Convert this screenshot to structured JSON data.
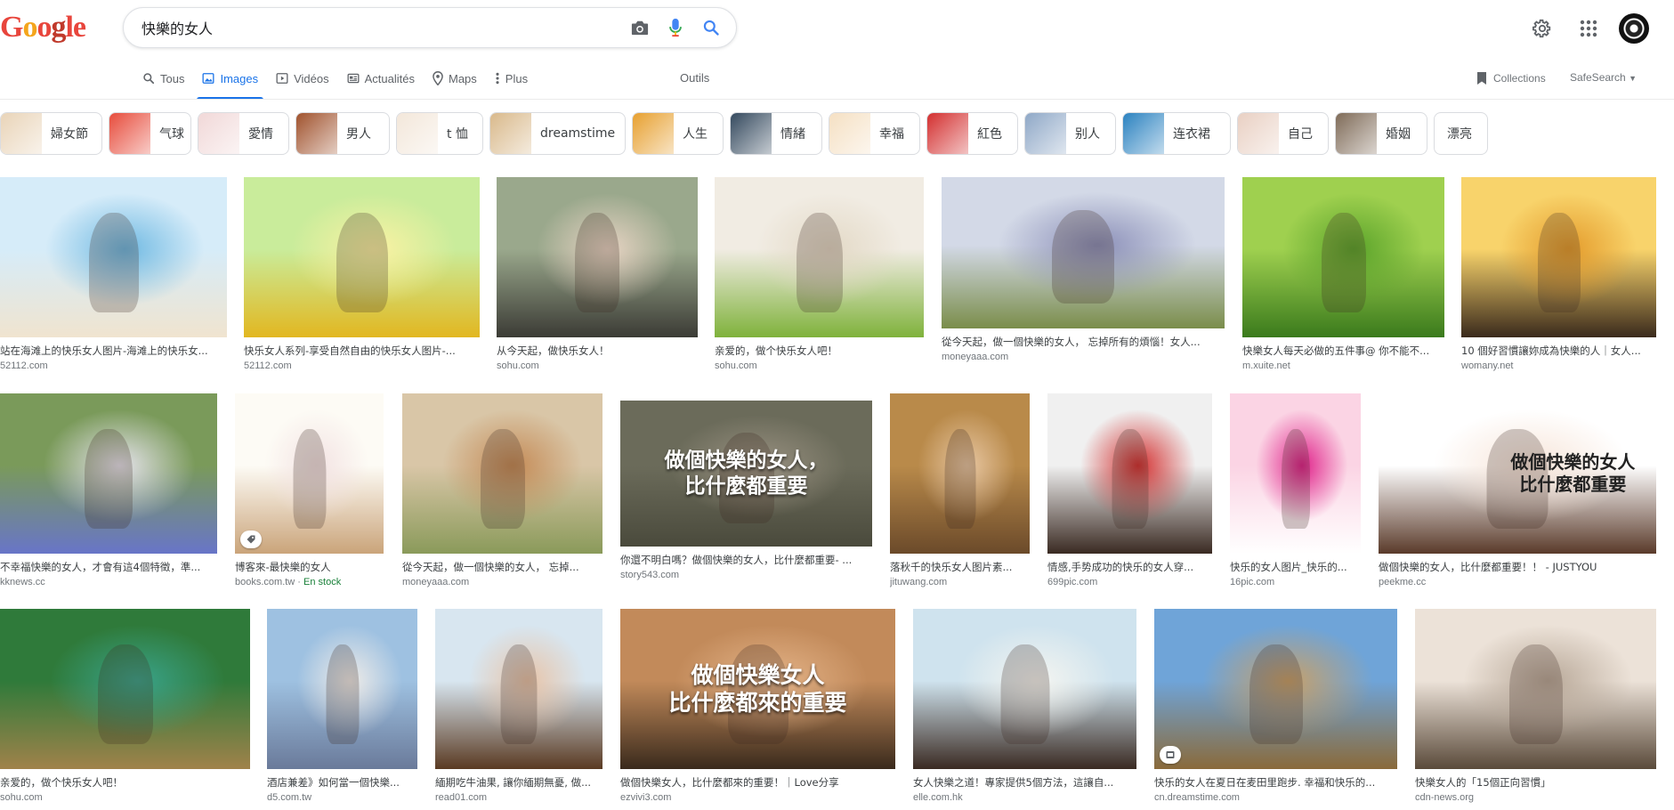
{
  "app": {
    "logo": [
      "G",
      "o",
      "o",
      "g",
      "l",
      "e"
    ],
    "logo_colors": [
      "#e8453c",
      "#f4a51c",
      "#e8453c",
      "#c0392b",
      "#e8453c",
      "#e8453c"
    ]
  },
  "search": {
    "query": "快樂的女人",
    "placeholder": ""
  },
  "tabs": [
    {
      "label": "Tous",
      "icon": "search-icon",
      "active": false
    },
    {
      "label": "Images",
      "icon": "image-icon",
      "active": true
    },
    {
      "label": "Vidéos",
      "icon": "play-icon",
      "active": false
    },
    {
      "label": "Actualités",
      "icon": "news-icon",
      "active": false
    },
    {
      "label": "Maps",
      "icon": "map-pin-icon",
      "active": false
    },
    {
      "label": "Plus",
      "icon": "more-vert-icon",
      "active": false
    }
  ],
  "tools_label": "Outils",
  "collections_label": "Collections",
  "safesearch_label": "SafeSearch",
  "chips": [
    {
      "label": "婦女節",
      "color": "#e9d4b8"
    },
    {
      "label": "气球",
      "color": "#e74c3c"
    },
    {
      "label": "愛情",
      "color": "#f1d8d8"
    },
    {
      "label": "男人",
      "color": "#a0522d"
    },
    {
      "label": "t 恤",
      "color": "#f3e7da"
    },
    {
      "label": "dreamstime",
      "color": "#d9b98b"
    },
    {
      "label": "人生",
      "color": "#e7a030"
    },
    {
      "label": "情緒",
      "color": "#34495e"
    },
    {
      "label": "幸福",
      "color": "#f5e0c3"
    },
    {
      "label": "紅色",
      "color": "#d32f2f"
    },
    {
      "label": "别人",
      "color": "#8fa8c7"
    },
    {
      "label": "连衣裙",
      "color": "#2b82c0"
    },
    {
      "label": "自己",
      "color": "#e9d0c3"
    },
    {
      "label": "婚姻",
      "color": "#7f6b58"
    },
    {
      "label": "漂亮",
      "color": ""
    }
  ],
  "results": [
    {
      "caption": "站在海滩上的快乐女人图片-海滩上的快乐女...",
      "source": "52112.com",
      "colors": [
        "#d6ecf9",
        "#6fb9e2",
        "#f0e4cf"
      ]
    },
    {
      "caption": "快乐女人系列-享受自然自由的快乐女人图片-...",
      "source": "52112.com",
      "colors": [
        "#c9ec9b",
        "#fbf2a3",
        "#e2b720"
      ]
    },
    {
      "caption": "从今天起，做快乐女人！",
      "source": "sohu.com",
      "colors": [
        "#9aa88c",
        "#e8d4c4",
        "#3b3b35"
      ]
    },
    {
      "caption": "亲爱的，做个快乐女人吧！",
      "source": "sohu.com",
      "colors": [
        "#f1ece3",
        "#e3d9c6",
        "#7fb23b"
      ]
    },
    {
      "caption": "從今天起，做一個快樂的女人， 忘掉所有的煩惱！女人...",
      "source": "moneyaaa.com",
      "colors": [
        "#d3d9e7",
        "#8b8fb8",
        "#7a8d4a"
      ]
    },
    {
      "caption": "快樂女人每天必做的五件事@ 你不能不...",
      "source": "m.xuite.net",
      "colors": [
        "#9fd04f",
        "#5aa32a",
        "#3a7a1c"
      ]
    },
    {
      "caption": "10 個好習慣讓妳成為快樂的人｜女人...",
      "source": "womany.net",
      "colors": [
        "#f8d36b",
        "#e49b2b",
        "#3a2a1c"
      ]
    },
    {
      "caption": "不幸福快樂的女人，才會有這4個特徵，準...",
      "source": "kknews.cc",
      "colors": [
        "#7a9a5a",
        "#e7e4ee",
        "#6875c8"
      ]
    },
    {
      "caption": "博客來-最快樂的女人",
      "source": "books.com.tw",
      "stock": "En stock",
      "colors": [
        "#fdfbf5",
        "#f3e3e3",
        "#caa47a"
      ]
    },
    {
      "caption": "從今天起，做一個快樂的女人， 忘掉...",
      "source": "moneyaaa.com",
      "colors": [
        "#d9c6a7",
        "#c48a55",
        "#8a9a5a"
      ]
    },
    {
      "caption": "你還不明白嗎？做個快樂的女人，比什麼都重要- ...",
      "source": "story543.com",
      "colors": [
        "#6b6b5a",
        "#9a9282",
        "#4a4a3c"
      ],
      "overlay": "做個快樂的女人，\n比什麼都重要"
    },
    {
      "caption": "落秋千的快乐女人图片素...",
      "source": "jituwang.com",
      "colors": [
        "#b98a4a",
        "#e8c7a3",
        "#6b4a2a"
      ]
    },
    {
      "caption": "情感,手势成功的快乐的女人穿...",
      "source": "699pic.com",
      "colors": [
        "#f0f0f0",
        "#d32f2f",
        "#3a2a22"
      ]
    },
    {
      "caption": "快乐的女人图片_快乐的...",
      "source": "16pic.com",
      "colors": [
        "#fbd4e4",
        "#e0218a",
        "#fff"
      ]
    },
    {
      "caption": "做個快樂的女人，比什麼都重要！！ - JUSTYOU",
      "source": "peekme.cc",
      "colors": [
        "#ffffff",
        "#f7e5d9",
        "#5a3a2a"
      ],
      "overlay": "做個快樂的女人\n比什麼都重要"
    },
    {
      "caption": "亲爱的，做个快乐女人吧！",
      "source": "sohu.com",
      "colors": [
        "#2f7a3a",
        "#3aa38a",
        "#a0824a"
      ]
    },
    {
      "caption": "酒店兼差》如何當一個快樂...",
      "source": "d5.com.tw",
      "colors": [
        "#9ec1e1",
        "#f0ece8",
        "#6a7a9a"
      ]
    },
    {
      "caption": "緬期吃牛油果, 讓你緬期無憂, 做...",
      "source": "read01.com",
      "colors": [
        "#d8e6f0",
        "#e8c4a8",
        "#5a3a22"
      ]
    },
    {
      "caption": "做個快樂女人，比什麼都來的重要！｜Love分享",
      "source": "ezvivi3.com",
      "colors": [
        "#c28a5a",
        "#e5b58a",
        "#3a2a1c"
      ],
      "overlay": "做個快樂女人\n比什麼都來的重要"
    },
    {
      "caption": "女人快樂之道！專家提供5個方法，這讓自...",
      "source": "elle.com.hk",
      "colors": [
        "#cfe3ee",
        "#f5f5f0",
        "#3a2a22"
      ]
    },
    {
      "caption": "快乐的女人在夏日在麦田里跑步. 幸福和快乐的...",
      "source": "cn.dreamstime.com",
      "colors": [
        "#6fa4d8",
        "#c8a068",
        "#8a6a3a"
      ]
    },
    {
      "caption": "快樂女人的「15個正向習慣」",
      "source": "cdn-news.org",
      "colors": [
        "#ece2d8",
        "#b8a898",
        "#5a4a3a"
      ]
    }
  ]
}
